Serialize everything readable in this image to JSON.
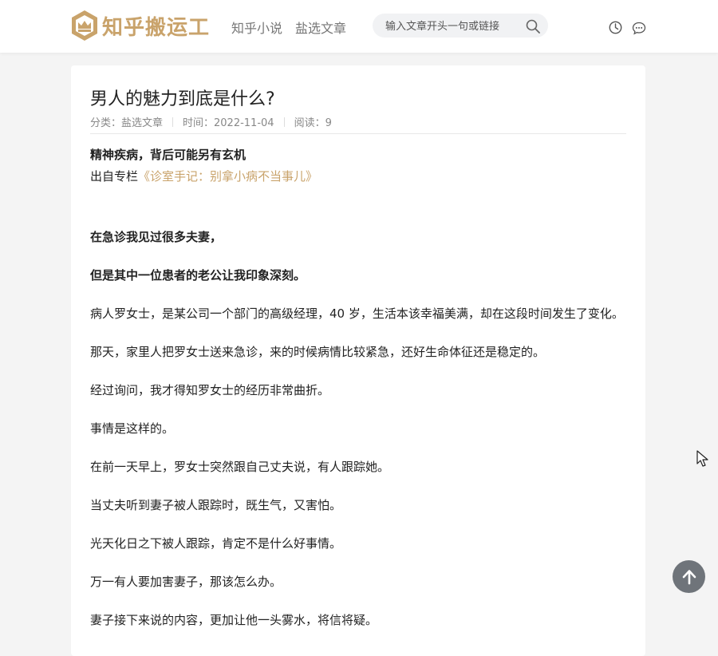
{
  "header": {
    "logo_text": "知乎搬运工",
    "nav": [
      "知乎小说",
      "盐选文章"
    ],
    "search_placeholder": "输入文章开头一句或链接",
    "icons": [
      "history-icon",
      "message-icon"
    ]
  },
  "article": {
    "title": "男人的魅力到底是什么?",
    "meta": {
      "category": "分类：盐选文章",
      "time": "时间：2022-11-04",
      "reads": "阅读：9"
    },
    "subhead": "精神疾病，背后可能另有玄机",
    "column_prefix": "出自专栏",
    "column_link": "《诊室手记：别拿小病不当事儿》",
    "paragraphs": [
      {
        "text": "在急诊我见过很多夫妻，",
        "bold": true
      },
      {
        "text": "但是其中一位患者的老公让我印象深刻。",
        "bold": true
      },
      {
        "text": "病人罗女士，是某公司一个部门的高级经理，40 岁，生活本该幸福美满，却在这段时间发生了变化。",
        "bold": false
      },
      {
        "text": "那天，家里人把罗女士送来急诊，来的时候病情比较紧急，还好生命体征还是稳定的。",
        "bold": false
      },
      {
        "text": "经过询问，我才得知罗女士的经历非常曲折。",
        "bold": false
      },
      {
        "text": "事情是这样的。",
        "bold": false
      },
      {
        "text": "在前一天早上，罗女士突然跟自己丈夫说，有人跟踪她。",
        "bold": false
      },
      {
        "text": "当丈夫听到妻子被人跟踪时，既生气，又害怕。",
        "bold": false
      },
      {
        "text": "光天化日之下被人跟踪，肯定不是什么好事情。",
        "bold": false
      },
      {
        "text": "万一有人要加害妻子，那该怎么办。",
        "bold": false
      },
      {
        "text": "妻子接下来说的内容，更加让他一头雾水，将信将疑。",
        "bold": false
      }
    ]
  },
  "colors": {
    "accent": "#c9a36b",
    "to_top_bg": "#6f747a"
  }
}
